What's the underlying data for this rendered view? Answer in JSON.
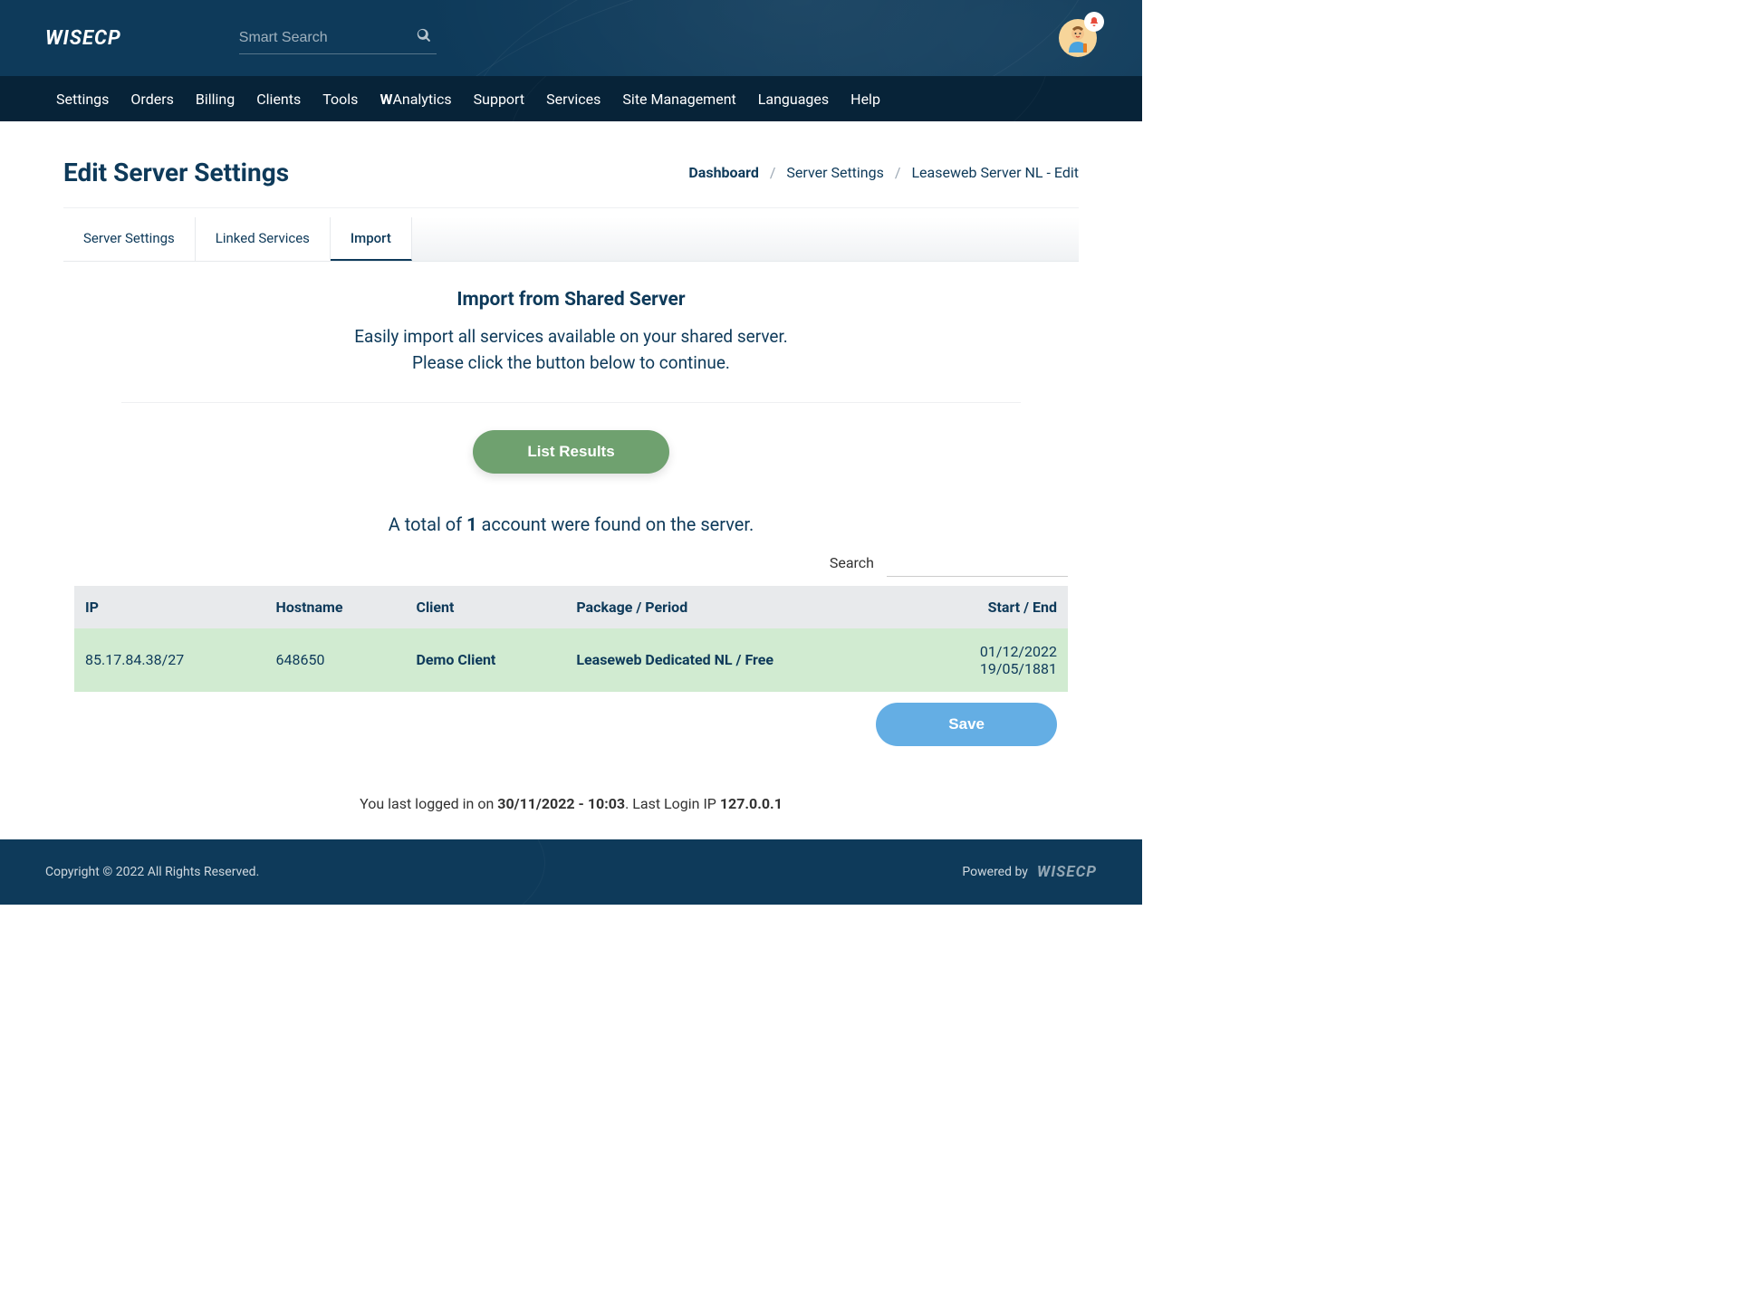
{
  "brand": "WISECP",
  "search": {
    "placeholder": "Smart Search"
  },
  "nav": {
    "items": [
      "Settings",
      "Orders",
      "Billing",
      "Clients",
      "Tools",
      "WAnalytics",
      "Support",
      "Services",
      "Site Management",
      "Languages",
      "Help"
    ]
  },
  "page_title": "Edit Server Settings",
  "breadcrumb": {
    "dashboard": "Dashboard",
    "server_settings": "Server Settings",
    "current": "Leaseweb Server NL - Edit"
  },
  "tabs": {
    "server_settings": "Server Settings",
    "linked_services": "Linked Services",
    "import": "Import"
  },
  "import_section": {
    "title": "Import from Shared Server",
    "line1": "Easily import all services available on your shared server.",
    "line2": "Please click the button below to continue.",
    "button": "List Results"
  },
  "summary": {
    "prefix": "A total of ",
    "count": "1",
    "suffix": " account were found on the server."
  },
  "table": {
    "search_label": "Search",
    "headers": {
      "ip": "IP",
      "hostname": "Hostname",
      "client": "Client",
      "package": "Package / Period",
      "start_end": "Start / End"
    },
    "rows": [
      {
        "ip": "85.17.84.38/27",
        "hostname": "648650",
        "client": "Demo Client",
        "package": "Leaseweb Dedicated NL / Free",
        "start": "01/12/2022",
        "end": "19/05/1881"
      }
    ]
  },
  "save_button": "Save",
  "last_login": {
    "prefix": "You last logged in on ",
    "datetime": "30/11/2022 - 10:03",
    "mid": ". Last Login IP ",
    "ip": "127.0.0.1"
  },
  "footer": {
    "copyright": "Copyright © 2022 All Rights Reserved.",
    "powered": "Powered by",
    "brand": "WISECP"
  }
}
